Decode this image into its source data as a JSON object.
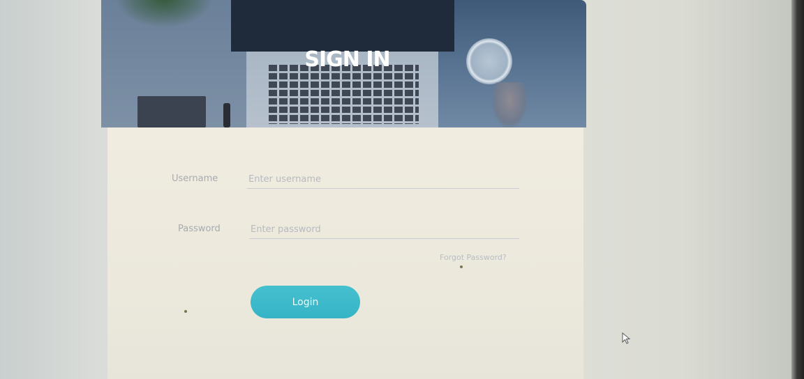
{
  "hero": {
    "title": "SIGN IN"
  },
  "form": {
    "username": {
      "label": "Username",
      "placeholder": "Enter username",
      "value": ""
    },
    "password": {
      "label": "Password",
      "placeholder": "Enter password",
      "value": ""
    },
    "forgot_link": "Forgot Password?",
    "login_label": "Login"
  },
  "colors": {
    "accent": "#3bb8c9",
    "panel_bg": "#eeebdf",
    "hero_bg": "#5a7593"
  },
  "icons": [
    "mouse-cursor-icon"
  ]
}
